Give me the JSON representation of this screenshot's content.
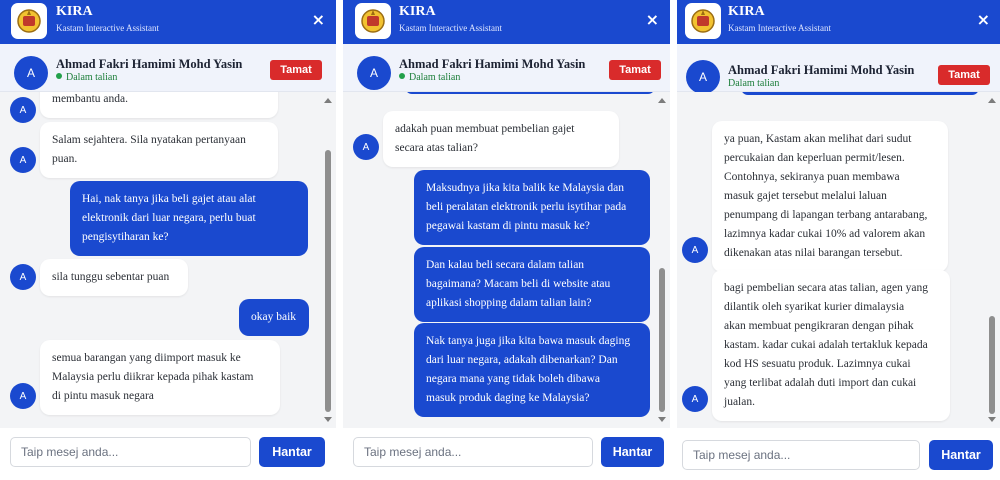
{
  "header": {
    "title": "KIRA",
    "subtitle": "Kastam Interactive Assistant",
    "close_icon": "×"
  },
  "agent": {
    "avatar_letter": "A",
    "name": "Ahmad Fakri Hamimi Mohd Yasin",
    "status": "Dalam talian",
    "end_label": "Tamat"
  },
  "input": {
    "placeholder": "Taip mesej anda...",
    "send_label": "Hantar"
  },
  "colors": {
    "primary": "#1a49cf",
    "danger": "#d92b2b",
    "online": "#22a04a",
    "chat_bg": "#f3f4f6"
  },
  "panel1": {
    "messages": [
      {
        "role": "bot",
        "lines": [
          "membantu anda."
        ]
      },
      {
        "role": "bot",
        "lines": [
          "Salam sejahtera. Sila nyatakan pertanyaan",
          "puan."
        ]
      },
      {
        "role": "user",
        "lines": [
          "Hai, nak tanya jika beli gajet atau alat",
          "elektronik dari luar negara, perlu buat",
          "pengisytiharan ke?"
        ]
      },
      {
        "role": "bot",
        "lines": [
          "sila tunggu sebentar puan"
        ]
      },
      {
        "role": "user",
        "lines": [
          "okay baik"
        ]
      },
      {
        "role": "bot",
        "lines": [
          "semua barangan yang diimport masuk ke",
          "Malaysia perlu diikrar kepada pihak kastam",
          "di pintu masuk negara"
        ]
      }
    ]
  },
  "panel2": {
    "messages": [
      {
        "role": "bot",
        "lines": [
          "adakah puan membuat pembelian gajet",
          "secara atas talian?"
        ]
      },
      {
        "role": "user",
        "lines": [
          "Maksudnya jika kita balik ke Malaysia dan",
          "beli peralatan elektronik perlu isytihar pada",
          "pegawai kastam di pintu masuk ke?"
        ]
      },
      {
        "role": "user",
        "lines": [
          "Dan kalau beli secara dalam talian",
          "bagaimana? Macam beli di website atau",
          "aplikasi shopping dalam talian lain?"
        ]
      },
      {
        "role": "user",
        "lines": [
          "Nak tanya juga jika kita bawa masuk daging",
          "dari luar negara, adakah dibenarkan? Dan",
          "negara mana yang tidak boleh dibawa",
          "masuk produk daging ke Malaysia?"
        ]
      }
    ]
  },
  "panel3": {
    "messages": [
      {
        "role": "bot",
        "lines": [
          "ya puan, Kastam akan melihat dari sudut",
          "percukaian dan keperluan permit/lesen.",
          "Contohnya, sekiranya puan membawa",
          "masuk gajet tersebut melalui laluan",
          "penumpang di lapangan terbang antarabang,",
          "lazimnya kadar cukai 10% ad valorem akan",
          "dikenakan atas nilai barangan tersebut."
        ]
      },
      {
        "role": "bot",
        "lines": [
          "bagi pembelian secara atas talian, agen yang",
          "dilantik oleh syarikat kurier dimalaysia",
          "akan membuat pengikraran dengan pihak",
          "kastam. kadar cukai adalah tertakluk kepada",
          "kod HS sesuatu produk. Lazimnya cukai",
          "yang terlibat adalah duti import dan cukai",
          "jualan."
        ]
      }
    ]
  }
}
